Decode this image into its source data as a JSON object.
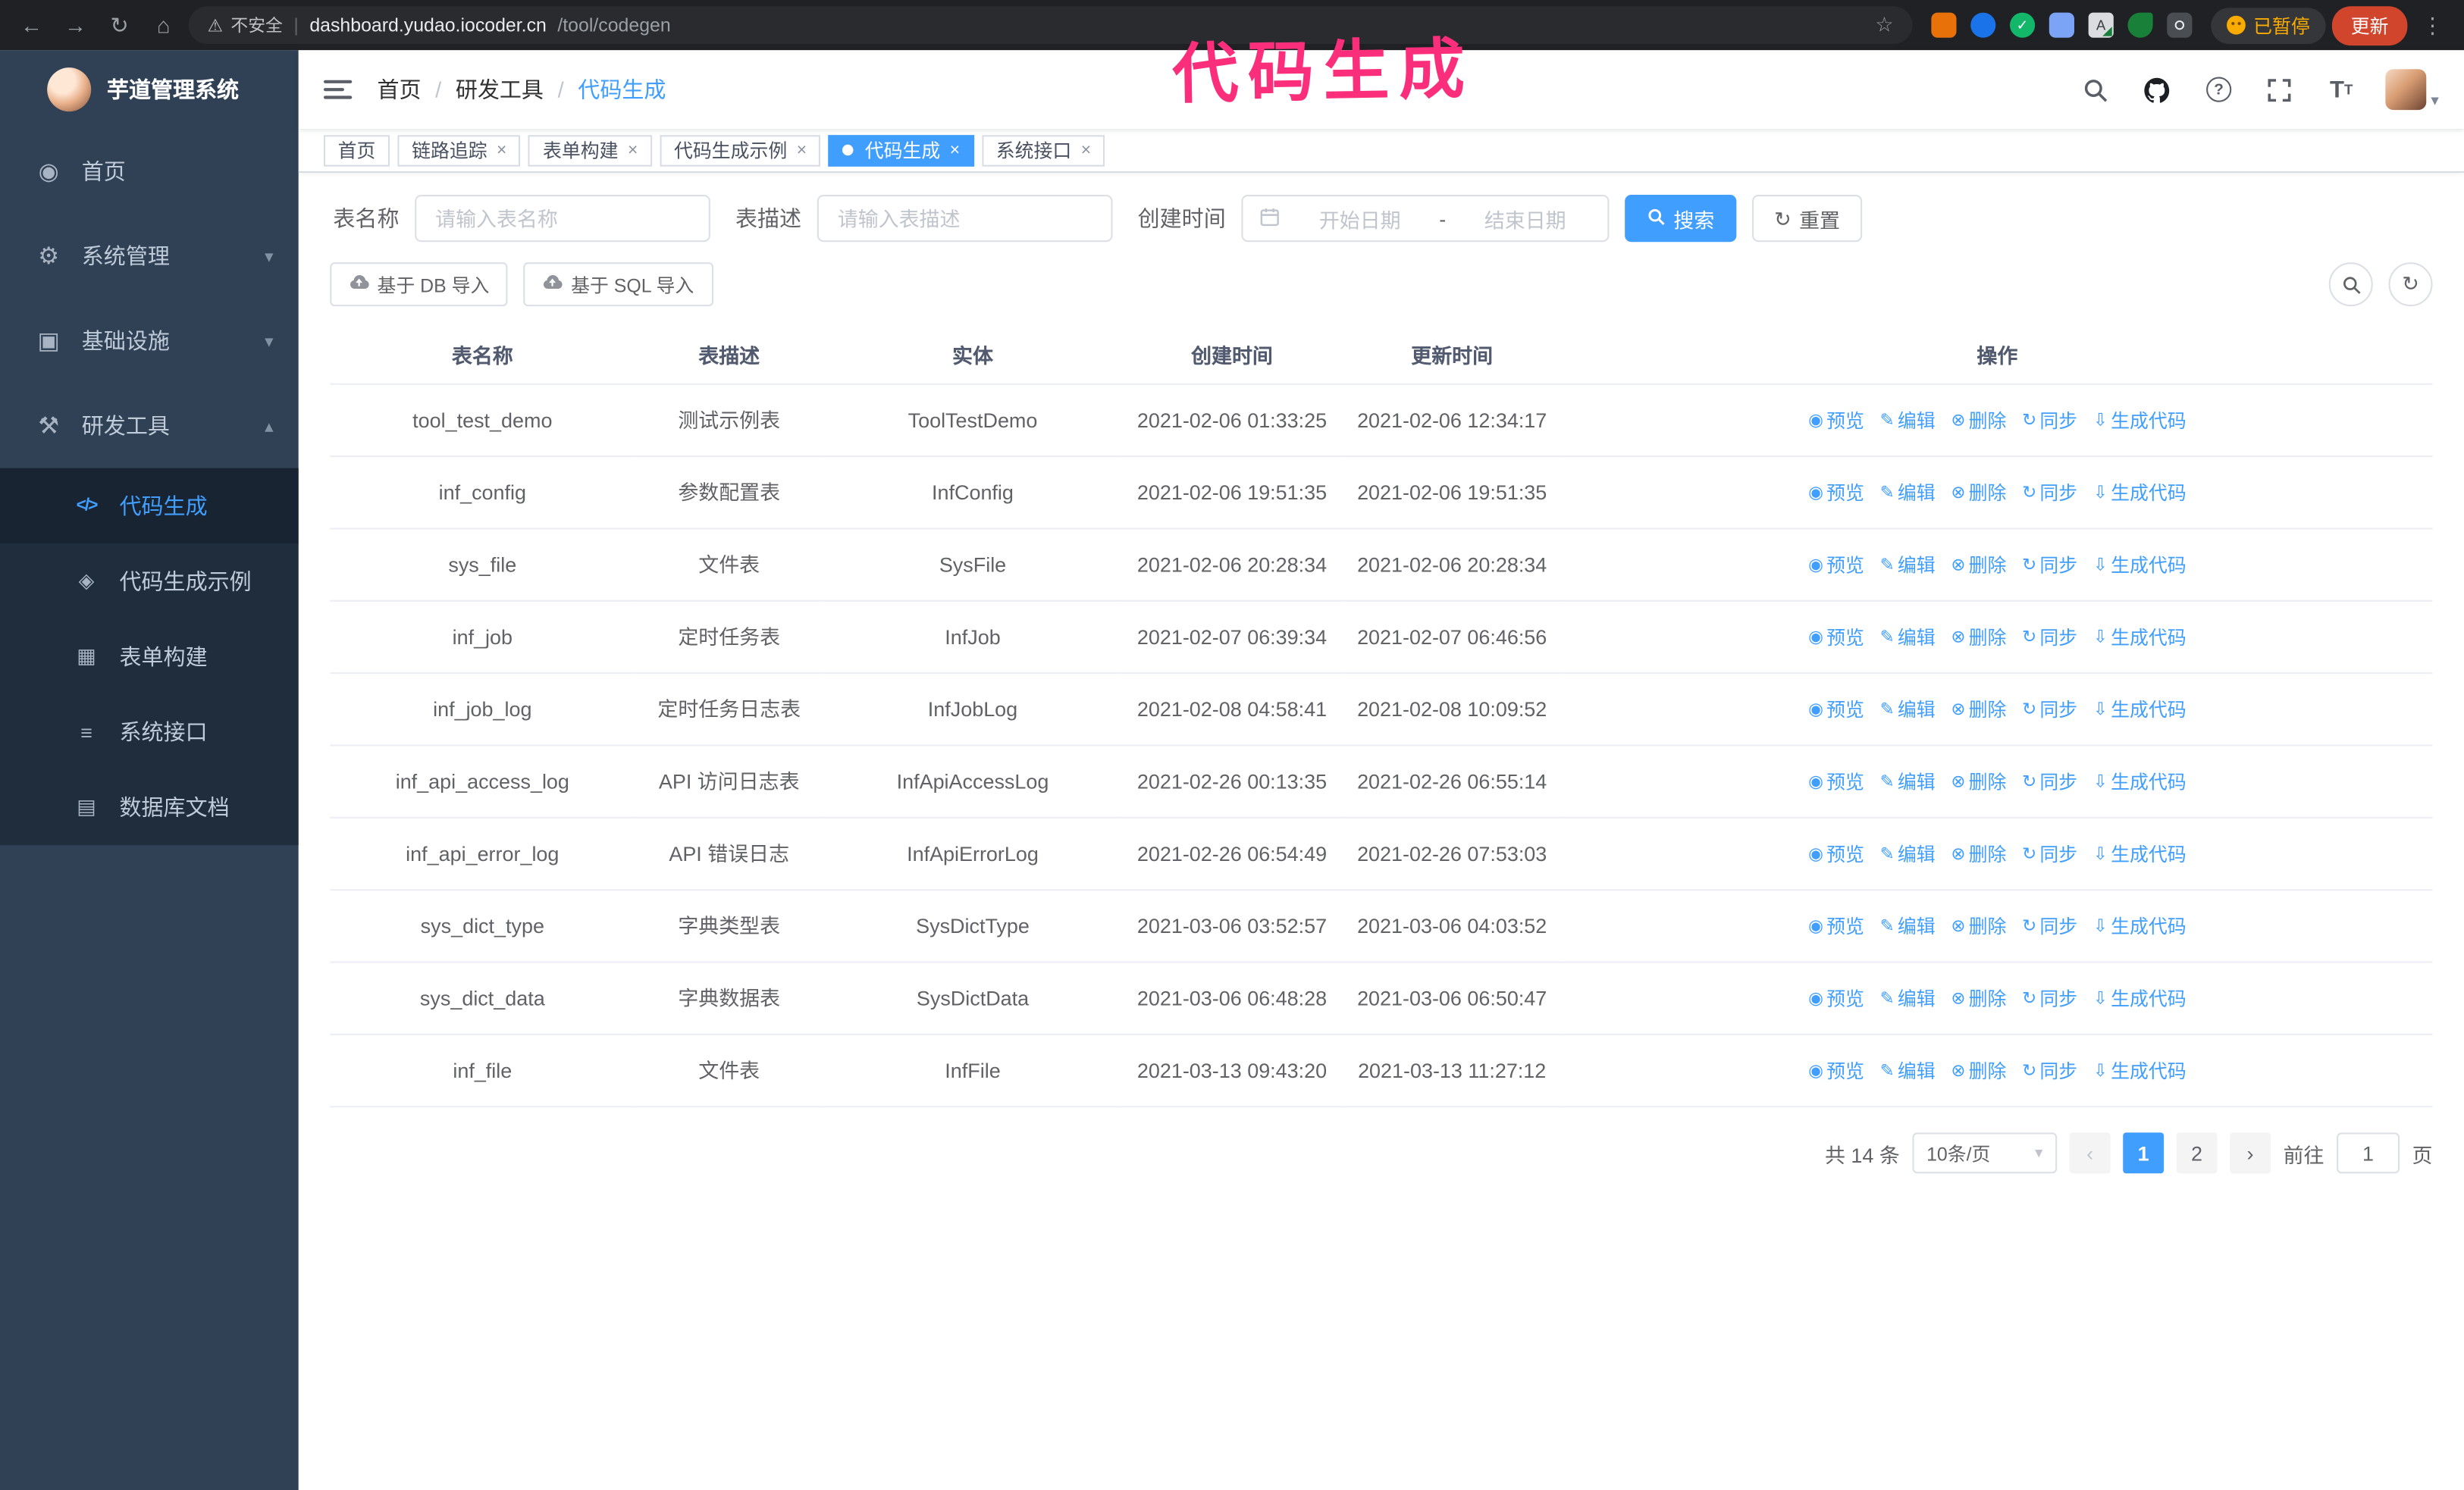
{
  "annotation": {
    "text": "代码生成",
    "color": "#fb2e7c"
  },
  "colors": {
    "accent": "#409eff",
    "sidebar_bg": "#304156",
    "submenu_bg": "#1f2d3d",
    "update_button_bg": "#d0452c",
    "paused_text": "#f9ab00"
  },
  "browser": {
    "security_label": "不安全",
    "url_domain": "dashboard.yudao.iocoder.cn",
    "url_path": "/tool/codegen",
    "paused_badge": "已暂停",
    "update_button": "更新"
  },
  "sidebar": {
    "logo_title": "芋道管理系统",
    "items": [
      {
        "label": "首页",
        "icon": "home-icon"
      },
      {
        "label": "系统管理",
        "icon": "gear-icon",
        "expandable": true
      },
      {
        "label": "基础设施",
        "icon": "monitor-icon",
        "expandable": true
      },
      {
        "label": "研发工具",
        "icon": "tools-icon",
        "expandable": true,
        "expanded": true,
        "children": [
          {
            "label": "代码生成",
            "icon": "code-icon",
            "active": true
          },
          {
            "label": "代码生成示例",
            "icon": "example-icon"
          },
          {
            "label": "表单构建",
            "icon": "form-icon"
          },
          {
            "label": "系统接口",
            "icon": "api-icon"
          },
          {
            "label": "数据库文档",
            "icon": "database-icon"
          }
        ]
      }
    ]
  },
  "navbar": {
    "breadcrumb": [
      "首页",
      "研发工具",
      "代码生成"
    ],
    "breadcrumb_separator": "/"
  },
  "tabs": [
    {
      "label": "首页",
      "closable": false,
      "active": false
    },
    {
      "label": "链路追踪",
      "closable": true,
      "active": false
    },
    {
      "label": "表单构建",
      "closable": true,
      "active": false
    },
    {
      "label": "代码生成示例",
      "closable": true,
      "active": false
    },
    {
      "label": "代码生成",
      "closable": true,
      "active": true
    },
    {
      "label": "系统接口",
      "closable": true,
      "active": false
    }
  ],
  "filters": {
    "table_name_label": "表名称",
    "table_name_placeholder": "请输入表名称",
    "table_desc_label": "表描述",
    "table_desc_placeholder": "请输入表描述",
    "create_time_label": "创建时间",
    "date_start_placeholder": "开始日期",
    "date_separator": "-",
    "date_end_placeholder": "结束日期",
    "search_button": "搜索",
    "reset_button": "重置"
  },
  "toolbar": {
    "import_db": "基于 DB 导入",
    "import_sql": "基于 SQL 导入"
  },
  "table": {
    "columns": [
      "表名称",
      "表描述",
      "实体",
      "创建时间",
      "更新时间",
      "操作"
    ],
    "actions": [
      {
        "label": "预览",
        "name": "preview-action",
        "icon": "eye-icon"
      },
      {
        "label": "编辑",
        "name": "edit-action",
        "icon": "edit-icon"
      },
      {
        "label": "删除",
        "name": "delete-action",
        "icon": "delete-icon"
      },
      {
        "label": "同步",
        "name": "sync-action",
        "icon": "sync-icon"
      },
      {
        "label": "生成代码",
        "name": "generate-code-action",
        "icon": "download-icon"
      }
    ],
    "rows": [
      {
        "name": "tool_test_demo",
        "desc": "测试示例表",
        "entity": "ToolTestDemo",
        "created": "2021-02-06 01:33:25",
        "updated": "2021-02-06 12:34:17"
      },
      {
        "name": "inf_config",
        "desc": "参数配置表",
        "entity": "InfConfig",
        "created": "2021-02-06 19:51:35",
        "updated": "2021-02-06 19:51:35"
      },
      {
        "name": "sys_file",
        "desc": "文件表",
        "entity": "SysFile",
        "created": "2021-02-06 20:28:34",
        "updated": "2021-02-06 20:28:34"
      },
      {
        "name": "inf_job",
        "desc": "定时任务表",
        "entity": "InfJob",
        "created": "2021-02-07 06:39:34",
        "updated": "2021-02-07 06:46:56"
      },
      {
        "name": "inf_job_log",
        "desc": "定时任务日志表",
        "entity": "InfJobLog",
        "created": "2021-02-08 04:58:41",
        "updated": "2021-02-08 10:09:52"
      },
      {
        "name": "inf_api_access_log",
        "desc": "API 访问日志表",
        "entity": "InfApiAccessLog",
        "created": "2021-02-26 00:13:35",
        "updated": "2021-02-26 06:55:14"
      },
      {
        "name": "inf_api_error_log",
        "desc": "API 错误日志",
        "entity": "InfApiErrorLog",
        "created": "2021-02-26 06:54:49",
        "updated": "2021-02-26 07:53:03"
      },
      {
        "name": "sys_dict_type",
        "desc": "字典类型表",
        "entity": "SysDictType",
        "created": "2021-03-06 03:52:57",
        "updated": "2021-03-06 04:03:52"
      },
      {
        "name": "sys_dict_data",
        "desc": "字典数据表",
        "entity": "SysDictData",
        "created": "2021-03-06 06:48:28",
        "updated": "2021-03-06 06:50:47"
      },
      {
        "name": "inf_file",
        "desc": "文件表",
        "entity": "InfFile",
        "created": "2021-03-13 09:43:20",
        "updated": "2021-03-13 11:27:12"
      }
    ]
  },
  "pagination": {
    "total_text": "共 14 条",
    "page_size": "10条/页",
    "pages": [
      "1",
      "2"
    ],
    "active_page": "1",
    "goto_label": "前往",
    "goto_value": "1",
    "goto_suffix": "页"
  }
}
